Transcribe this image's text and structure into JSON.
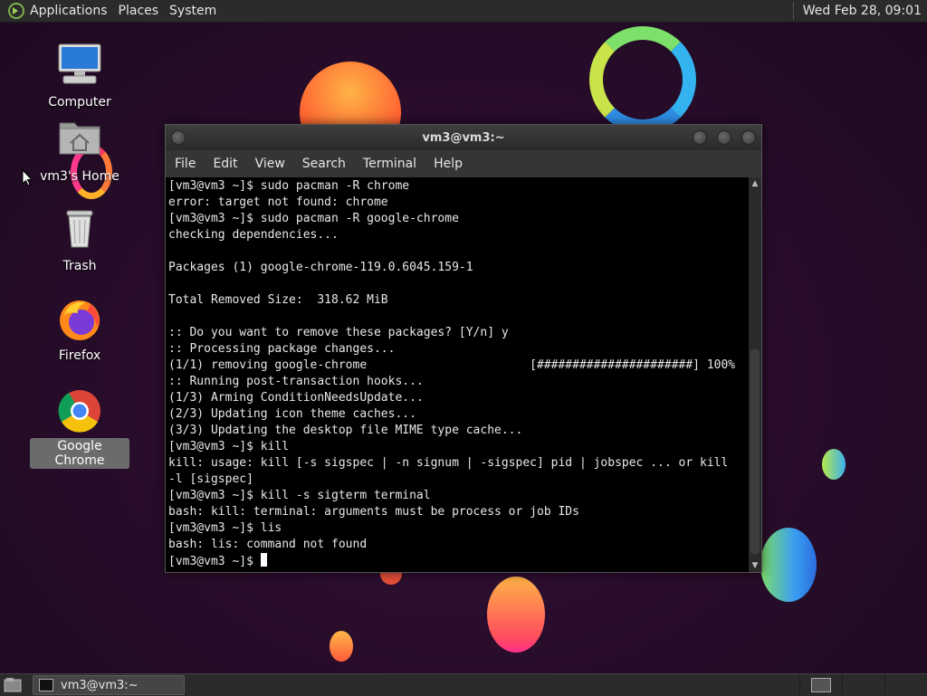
{
  "top_panel": {
    "menus": [
      "Applications",
      "Places",
      "System"
    ],
    "clock": "Wed Feb 28, 09:01"
  },
  "desktop_icons": [
    {
      "label": "Computer",
      "icon": "computer-icon"
    },
    {
      "label": "vm3's Home",
      "icon": "home-folder-icon"
    },
    {
      "label": "Trash",
      "icon": "trash-icon"
    },
    {
      "label": "Firefox",
      "icon": "firefox-icon"
    },
    {
      "label": "Google Chrome",
      "icon": "chrome-icon",
      "selected": true
    }
  ],
  "terminal": {
    "title": "vm3@vm3:~",
    "menus": [
      "File",
      "Edit",
      "View",
      "Search",
      "Terminal",
      "Help"
    ],
    "lines": [
      "[vm3@vm3 ~]$ sudo pacman -R chrome",
      "error: target not found: chrome",
      "[vm3@vm3 ~]$ sudo pacman -R google-chrome",
      "checking dependencies...",
      "",
      "Packages (1) google-chrome-119.0.6045.159-1",
      "",
      "Total Removed Size:  318.62 MiB",
      "",
      ":: Do you want to remove these packages? [Y/n] y",
      ":: Processing package changes...",
      "(1/1) removing google-chrome                       [######################] 100%",
      ":: Running post-transaction hooks...",
      "(1/3) Arming ConditionNeedsUpdate...",
      "(2/3) Updating icon theme caches...",
      "(3/3) Updating the desktop file MIME type cache...",
      "[vm3@vm3 ~]$ kill",
      "kill: usage: kill [-s sigspec | -n signum | -sigspec] pid | jobspec ... or kill",
      "-l [sigspec]",
      "[vm3@vm3 ~]$ kill -s sigterm terminal",
      "bash: kill: terminal: arguments must be process or job IDs",
      "[vm3@vm3 ~]$ lis",
      "bash: lis: command not found"
    ],
    "prompt": "[vm3@vm3 ~]$ "
  },
  "taskbar": {
    "task_label": "vm3@vm3:~"
  },
  "colors": {
    "panel": "#2b2b2b",
    "terminal_bg": "#000000",
    "terminal_fg": "#e8e8e8"
  }
}
